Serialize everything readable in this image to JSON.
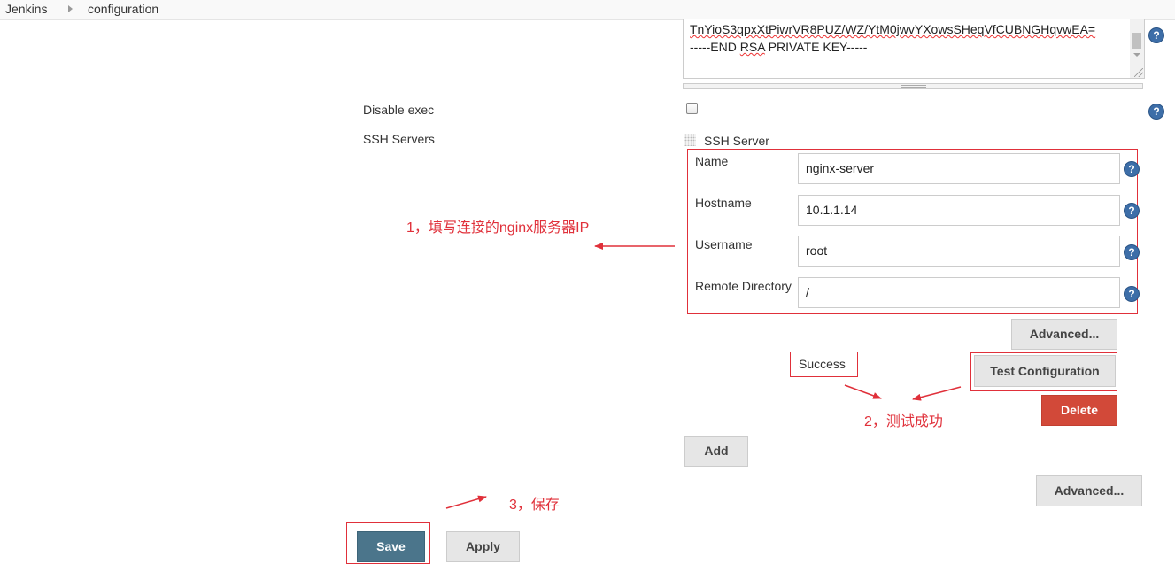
{
  "breadcrumb": {
    "items": [
      "Jenkins",
      "configuration"
    ]
  },
  "key_textarea": {
    "line1": "TnYioS3qpxXtPiwrVR8PUZ/WZ/YtM0jwvYXowsSHeqVfCUBNGHqvwEA=",
    "line2_prefix": "-----END ",
    "line2_word": "RSA",
    "line2_suffix": " PRIVATE KEY-----"
  },
  "help_icon_glyph": "?",
  "disable_exec": {
    "label": "Disable exec",
    "checked": false
  },
  "ssh_servers": {
    "label": "SSH Servers",
    "section_title": "SSH Server",
    "fields": {
      "name": {
        "label": "Name",
        "value": "nginx-server"
      },
      "hostname": {
        "label": "Hostname",
        "value": "10.1.1.14"
      },
      "username": {
        "label": "Username",
        "value": "root"
      },
      "remote_directory": {
        "label": "Remote Directory",
        "value": "/"
      }
    },
    "advanced_label": "Advanced...",
    "status_text": "Success",
    "test_configuration_label": "Test Configuration",
    "delete_label": "Delete",
    "add_label": "Add"
  },
  "outer_advanced_label": "Advanced...",
  "footer": {
    "save_label": "Save",
    "apply_label": "Apply"
  },
  "annotations": {
    "note1": "1，填写连接的nginx服务器IP",
    "note2": "2，测试成功",
    "note3": "3，保存"
  },
  "colors": {
    "annotation_red": "#e0303a",
    "help_blue": "#3d6ea8",
    "delete_red": "#d24939",
    "save_blue": "#4b758b"
  }
}
